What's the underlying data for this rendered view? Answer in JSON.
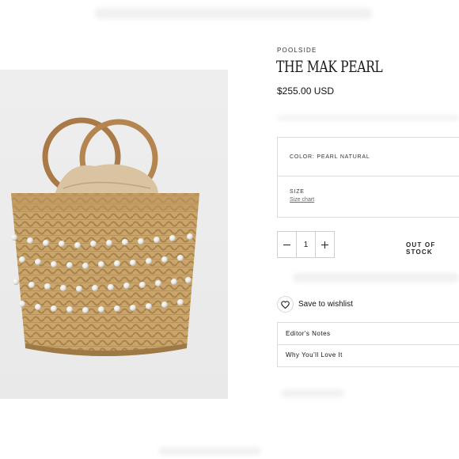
{
  "product": {
    "brand": "POOLSIDE",
    "title": "THE MAK PEARL",
    "price": "$255.00 USD",
    "image_alt": "straw basket bag with pearls and wooden round handles"
  },
  "options": {
    "color_label": "COLOR: PEARL NATURAL",
    "size_label": "SIZE",
    "size_chart_link": "Size chart"
  },
  "quantity": {
    "value": "1",
    "minus_icon": "minus-icon",
    "plus_icon": "plus-icon"
  },
  "stock_status": "OUT OF STOCK",
  "wishlist": {
    "label": "Save to wishlist",
    "icon": "heart-icon"
  },
  "accordions": [
    {
      "label": "Editor's Notes"
    },
    {
      "label": "Why You'll Love It"
    }
  ],
  "colors": {
    "image_bg": "#ececec",
    "straw": "#c9a46b",
    "border": "#dcdcdc",
    "text": "#1a1a1a"
  }
}
